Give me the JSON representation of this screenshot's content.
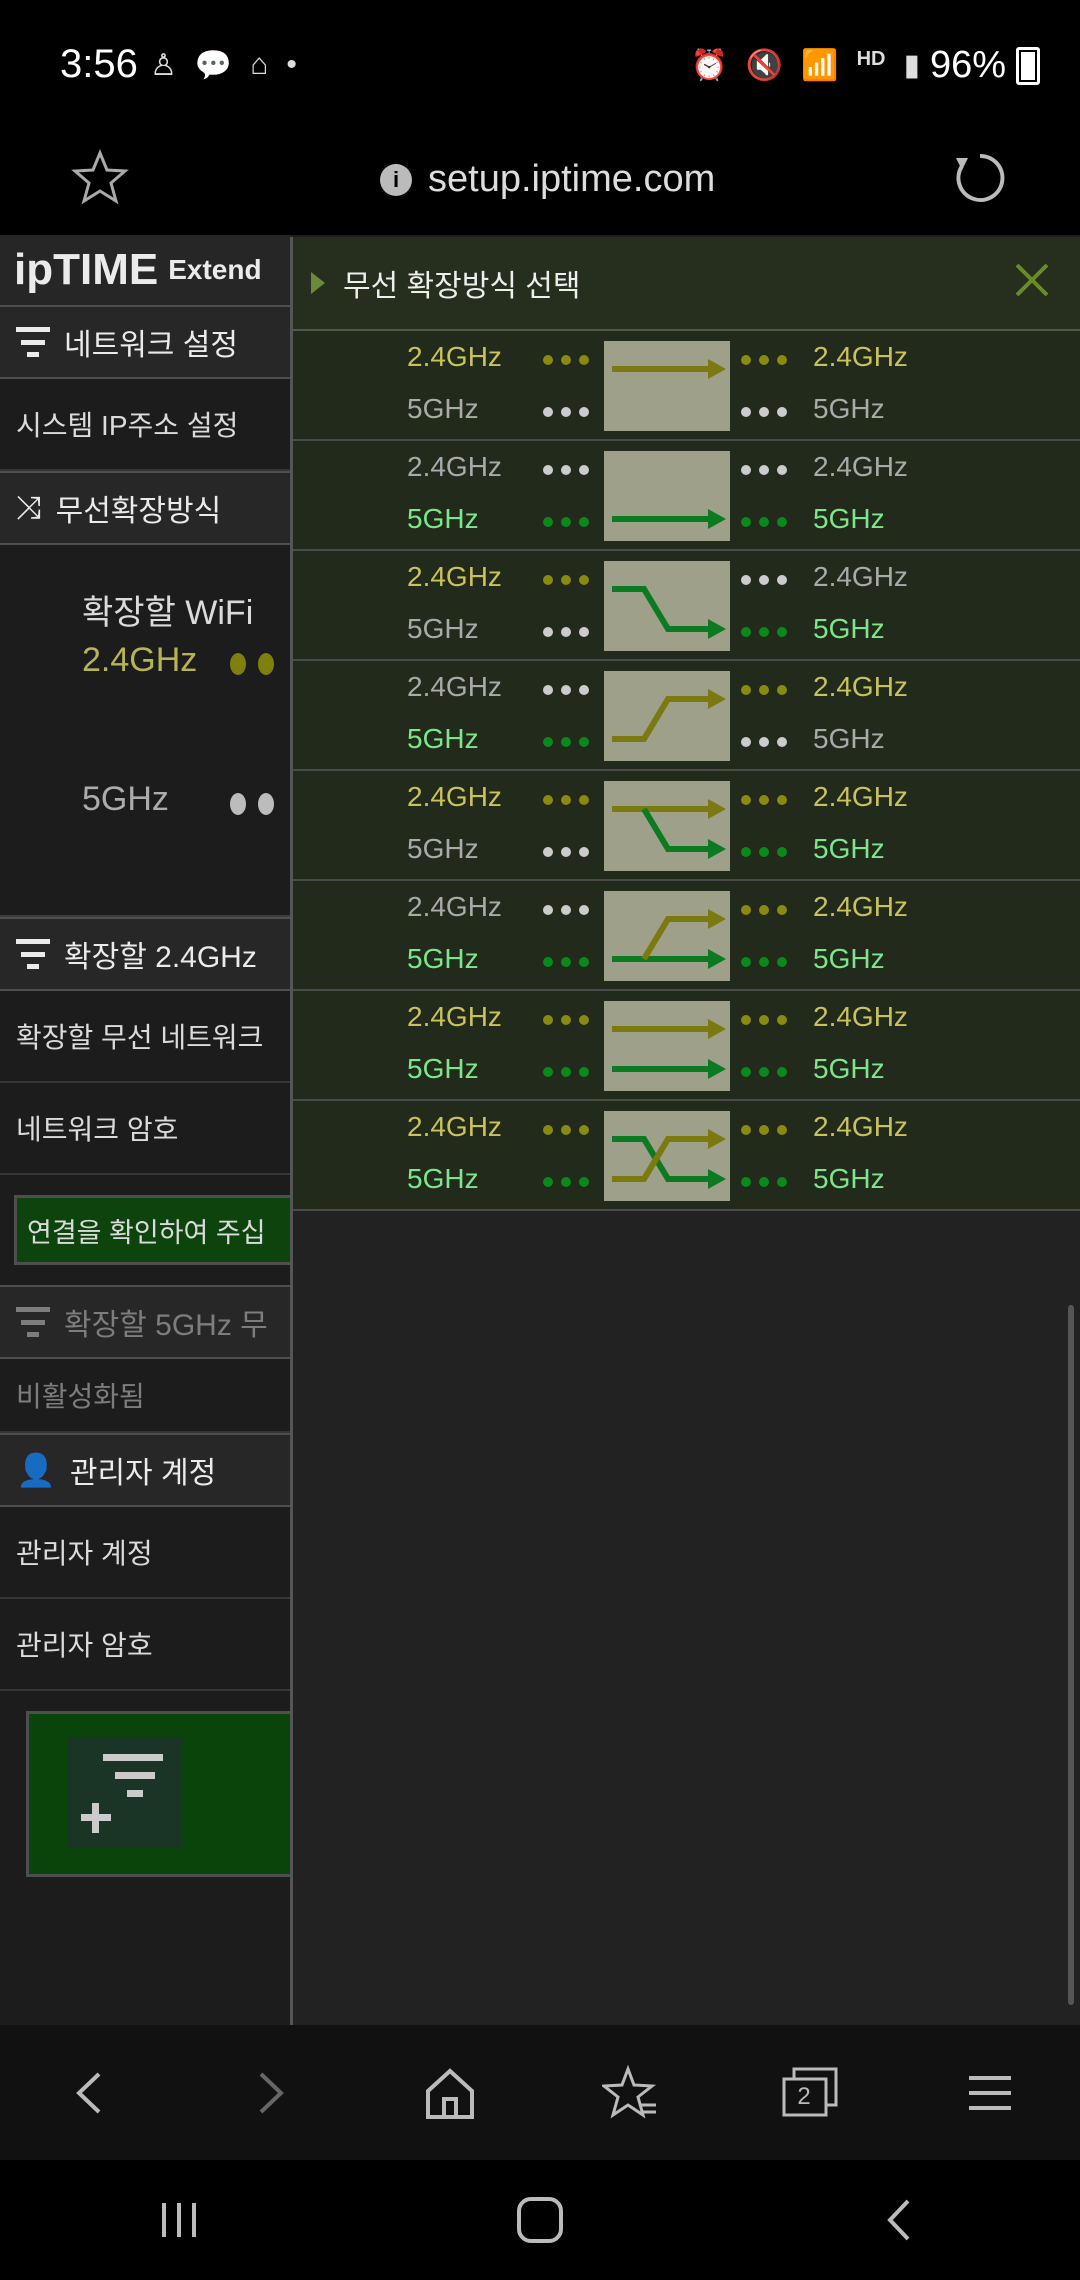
{
  "status": {
    "time": "3:56",
    "notif_icons": [
      "kakao-icon",
      "talk-icon",
      "smarthome-icon",
      "dot-icon"
    ],
    "right_icons": [
      "alarm-icon",
      "mute-icon",
      "wifi-icon",
      "hd-voice-icon",
      "signal-icon"
    ],
    "battery": "96%"
  },
  "browser": {
    "url": "setup.iptime.com",
    "tabs_count": "2"
  },
  "leftnav": {
    "logo": "ipTIME",
    "logo_ext": "Extend",
    "network_section": "네트워크 설정",
    "system_ip": "시스템 IP주소 설정",
    "wireless_mode": "무선확장방식",
    "extend_wifi": "확장할 WiFi",
    "g24": "2.4GHz",
    "g5": "5GHz",
    "ext24_section": "확장할 2.4GHz",
    "ext_network": "확장할 무선 네트워크",
    "net_password": "네트워크 암호",
    "confirm": "연결을 확인하여 주십",
    "ext5_section": "확장할 5GHz 무",
    "disabled": "비활성화됨",
    "admin_section": "관리자 계정",
    "admin_account": "관리자 계정",
    "admin_password": "관리자 암호"
  },
  "popup": {
    "title": "무선 확장방식 선택",
    "band24": "2.4GHz",
    "band5": "5GHz"
  },
  "colors": {
    "yellow_band": "#c9c35a",
    "green_band": "#7ee68a",
    "inactive": "#aaaaaa",
    "olive_arrow": "#7a7a10",
    "green_arrow": "#0c7a20"
  }
}
